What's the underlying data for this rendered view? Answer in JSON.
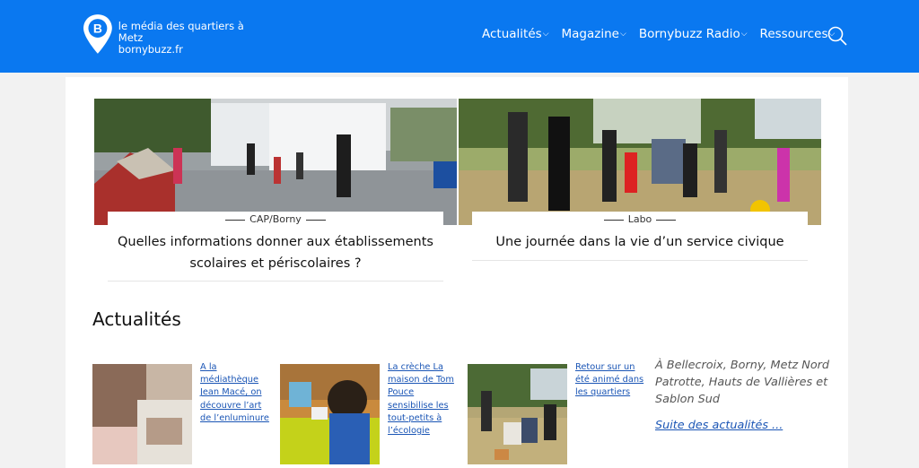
{
  "header": {
    "tagline": "le média des quartiers à Metz",
    "site": "bornybuzz.fr",
    "logo_letter": "B",
    "nav": [
      {
        "label": "Actualités",
        "chevron": "⌵"
      },
      {
        "label": "Magazine",
        "chevron": "⌵"
      },
      {
        "label": "Bornybuzz Radio",
        "chevron": "⌵"
      },
      {
        "label": "Ressources",
        "chevron": "⌵"
      }
    ],
    "search_icon": "search-icon",
    "bg_color": "#0a78f0"
  },
  "featured": [
    {
      "category": "CAP/Borny",
      "title": "Quelles informations donner aux établissements scolaires et périscolaires ?"
    },
    {
      "category": "Labo",
      "title": "Une journée dans la vie d’un service civique"
    }
  ],
  "section": {
    "title": "Actualités"
  },
  "news": [
    {
      "title": "A la médiathèque Jean Macé, on découvre l’art de l’enluminure"
    },
    {
      "title": "La crèche La maison de Tom Pouce sensibilise les tout-petits à l’écologie"
    },
    {
      "title": "Retour sur un été animé dans les quartiers"
    }
  ],
  "aside": {
    "text": "À Bellecroix, Borny, Metz Nord Patrotte, Hauts de Vallières et Sablon Sud",
    "link": "Suite des actualités ..."
  },
  "colors": {
    "link": "#1a55b5",
    "accent": "#0a78f0"
  }
}
